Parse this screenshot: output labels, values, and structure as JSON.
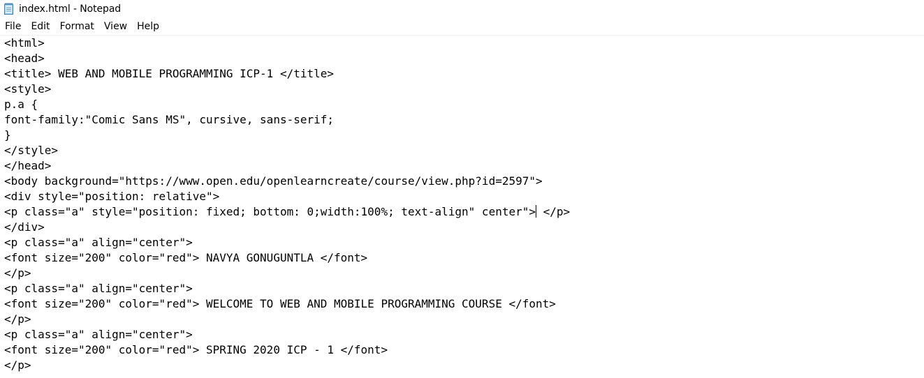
{
  "window": {
    "title": "index.html - Notepad",
    "app_icon": "notepad-icon"
  },
  "menu": {
    "file": "File",
    "edit": "Edit",
    "format": "Format",
    "view": "View",
    "help": "Help"
  },
  "document": {
    "lines": [
      "<html>",
      "<head>",
      "<title> WEB AND MOBILE PROGRAMMING ICP-1 </title>",
      "<style>",
      "p.a {",
      "font-family:\"Comic Sans MS\", cursive, sans-serif;",
      "}",
      "</style>",
      "</head>",
      "<body background=\"https://www.open.edu/openlearncreate/course/view.php?id=2597\">",
      "<div style=\"position: relative\">",
      "<p class=\"a\" style=\"position: fixed; bottom: 0;width:100%; text-align\" center\">",
      "</div>",
      "<p class=\"a\" align=\"center\">",
      "<font size=\"200\" color=\"red\"> NAVYA GONUGUNTLA </font>",
      "</p>",
      "<p class=\"a\" align=\"center\">",
      "<font size=\"200\" color=\"red\"> WELCOME TO WEB AND MOBILE PROGRAMMING COURSE </font>",
      "</p>",
      "<p class=\"a\" align=\"center\">",
      "<font size=\"200\" color=\"red\"> SPRING 2020 ICP - 1 </font>",
      "</p>"
    ],
    "caret_line_after": " </p>"
  }
}
